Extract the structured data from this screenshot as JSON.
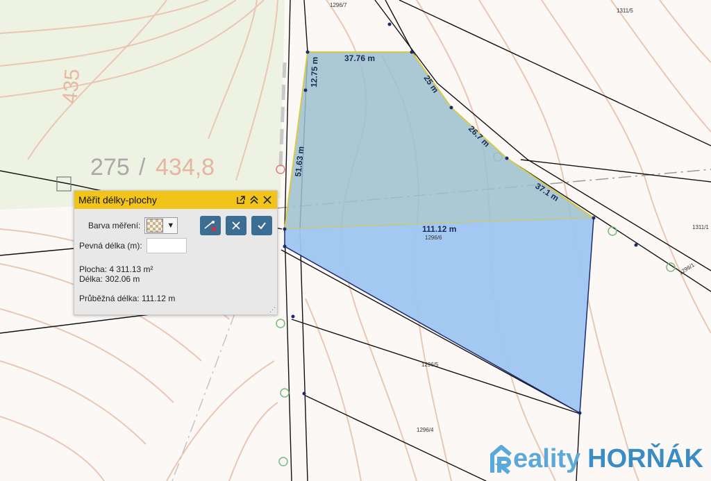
{
  "map": {
    "measure_labels": {
      "seg_top": "37.76 m",
      "seg_25": "25 m",
      "seg_267": "26.7 m",
      "seg_371": "37.1 m",
      "seg_1275": "12.75 m",
      "seg_5163": "51.63 m",
      "seg_11112": "111.12 m"
    },
    "parcel_labels": {
      "p1296_7": "1296/7",
      "p1311_5": "1311/5",
      "p1296_6": "1296/6",
      "p1311_1": "1311/1",
      "p1296_5": "1296/5",
      "p1296_4": "1296/4",
      "p1296_1": "1296/1"
    },
    "terrain": {
      "contour_435": "435",
      "height_a": "275",
      "height_sep": "/",
      "height_b": "434,8"
    },
    "colors": {
      "measure_fill_closed": "#9cc0cf",
      "measure_fill_open": "#9ec6f2",
      "measure_stroke": "#d8c94a",
      "polygon_edge": "#1d2a6e",
      "contour": "#eac6b4",
      "parcel_line": "#111111",
      "forest": "#eef2e2",
      "accent_yellow": "#f2c318",
      "button_blue": "#3c6d92"
    }
  },
  "panel": {
    "title": "Měřit délky-plochy",
    "icons": [
      "popout-icon",
      "collapse-icon",
      "close-icon"
    ],
    "color_label": "Barva měření:",
    "color_caret": "▼",
    "tools": [
      "clear-icon",
      "cancel-icon",
      "confirm-icon"
    ],
    "fixed_length_label": "Pevná délka (m):",
    "fixed_length_value": "",
    "area_text": "Plocha: 4 311.13 m²",
    "length_text": "Délka: 302.06 m",
    "running_length_text": "Průběžná délka: 111.12 m",
    "resize_glyph": "⋰"
  },
  "brand": {
    "part1": "eality",
    "part2": "HORŇÁK"
  }
}
